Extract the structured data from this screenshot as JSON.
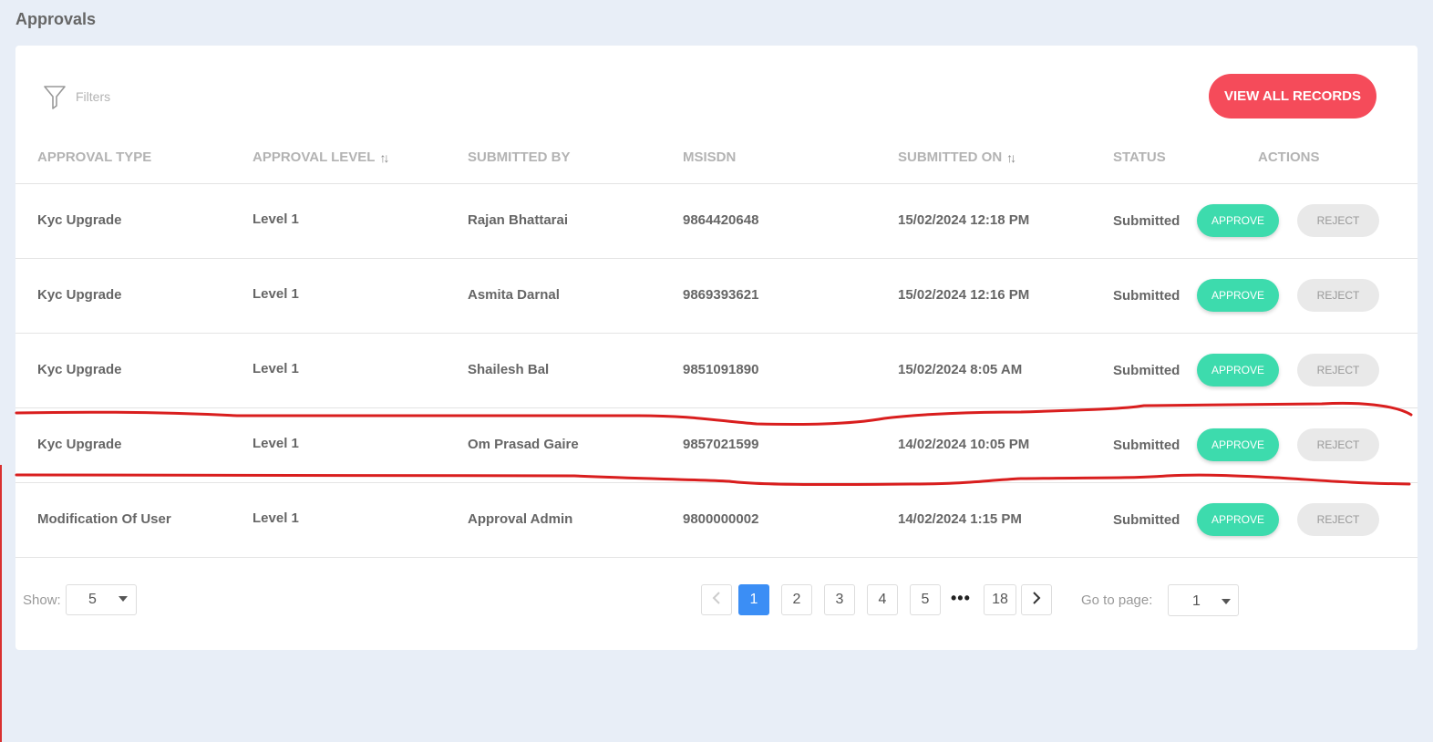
{
  "page": {
    "title": "Approvals"
  },
  "toolbar": {
    "filters_label": "Filters",
    "view_all_label": "VIEW ALL RECORDS"
  },
  "table": {
    "columns": [
      "APPROVAL TYPE",
      "APPROVAL LEVEL",
      "SUBMITTED BY",
      "MSISDN",
      "SUBMITTED ON",
      "STATUS",
      "ACTIONS"
    ],
    "rows": [
      {
        "type": "Kyc Upgrade",
        "level": "Level 1",
        "submitted_by": "Rajan Bhattarai",
        "msisdn": "9864420648",
        "submitted_on": "15/02/2024 12:18 PM",
        "status": "Submitted"
      },
      {
        "type": "Kyc Upgrade",
        "level": "Level 1",
        "submitted_by": "Asmita Darnal",
        "msisdn": "9869393621",
        "submitted_on": "15/02/2024 12:16 PM",
        "status": "Submitted"
      },
      {
        "type": "Kyc Upgrade",
        "level": "Level 1",
        "submitted_by": "Shailesh Bal",
        "msisdn": "9851091890",
        "submitted_on": "15/02/2024 8:05 AM",
        "status": "Submitted"
      },
      {
        "type": "Kyc Upgrade",
        "level": "Level 1",
        "submitted_by": "Om Prasad Gaire",
        "msisdn": "9857021599",
        "submitted_on": "14/02/2024 10:05 PM",
        "status": "Submitted"
      },
      {
        "type": "Modification Of User",
        "level": "Level 1",
        "submitted_by": "Approval Admin",
        "msisdn": "9800000002",
        "submitted_on": "14/02/2024 1:15 PM",
        "status": "Submitted"
      }
    ],
    "approve_label": "APPROVE",
    "reject_label": "REJECT"
  },
  "pagination": {
    "show_label": "Show:",
    "page_size": "5",
    "pages": [
      "1",
      "2",
      "3",
      "4",
      "5"
    ],
    "ellipsis": "•••",
    "last_page": "18",
    "current_page": "1",
    "goto_label": "Go to page:",
    "goto_value": "1"
  },
  "colors": {
    "accent_red": "#f54b5a",
    "approve_green": "#3ddbad",
    "active_page_blue": "#3b8ef5",
    "annotation_red": "#d91e1e"
  }
}
